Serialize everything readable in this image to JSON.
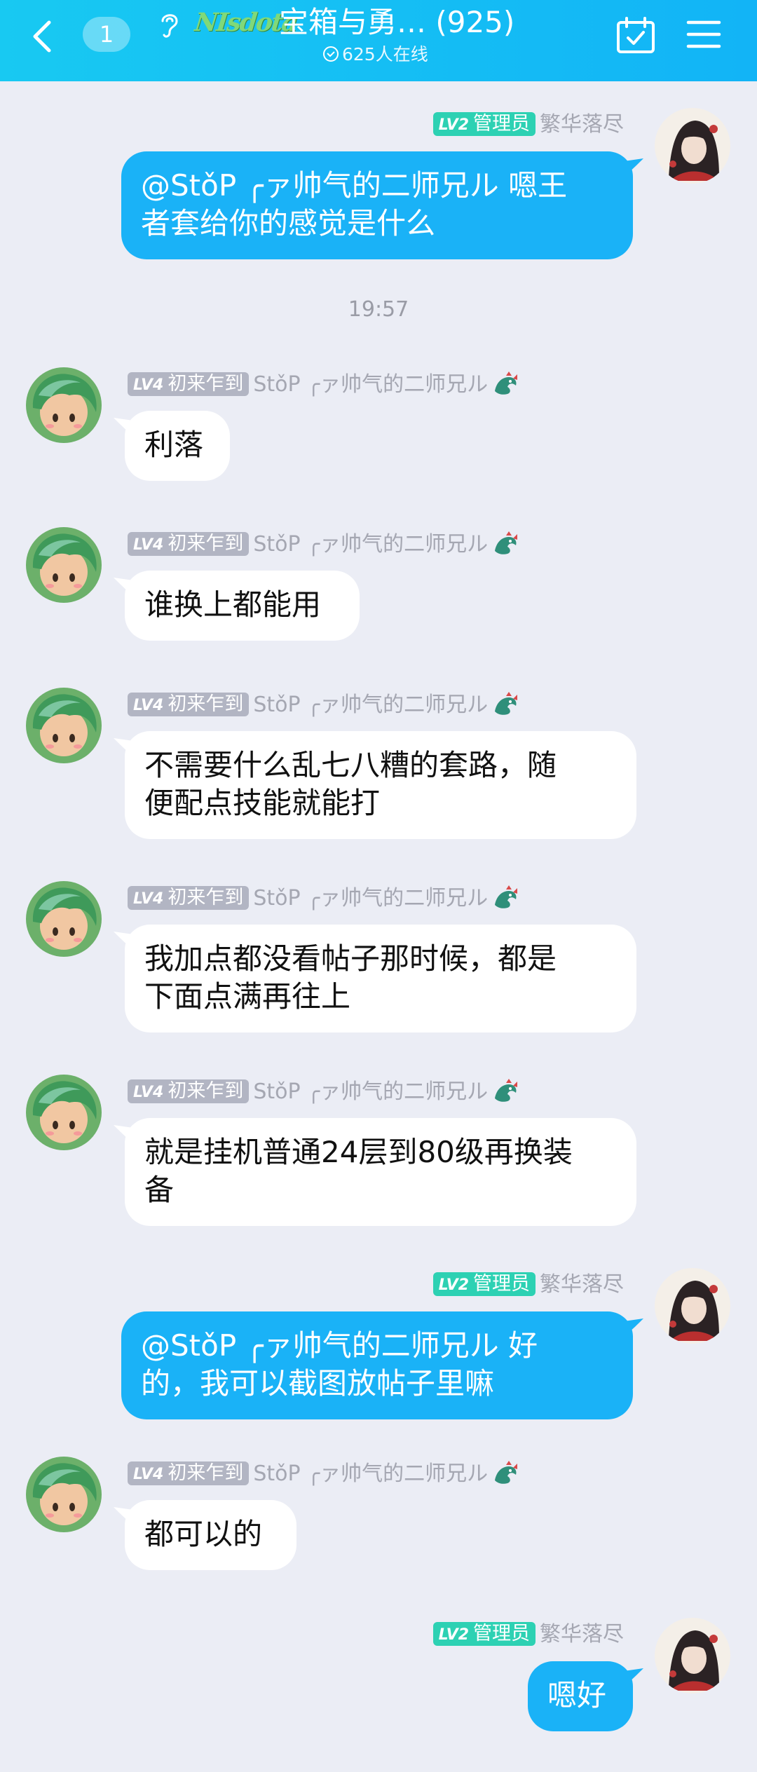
{
  "header": {
    "unread_count": "1",
    "group_logo": "NIsdota",
    "title": "宝箱与勇…  (925)",
    "online": "625人在线",
    "icons": [
      "back-icon",
      "ear-icon",
      "calendar-check-icon",
      "menu-icon"
    ]
  },
  "colors": {
    "header": "#18c9f2",
    "bubble_out": "#1ab2f7",
    "bubble_in": "#ffffff",
    "background": "#ebedf5",
    "lv4": "#b2b5c3",
    "lv2": "#2dd1b3"
  },
  "timestamp": "19:57",
  "messages": [
    {
      "side": "right",
      "level": "LV2",
      "role": "管理员",
      "name": "繁华落尽",
      "lines": [
        "@StǒP  ╭ァ帅气的二师兄ル 嗯王",
        "者套给你的感觉是什么"
      ]
    },
    {
      "side": "left",
      "level": "LV4",
      "role": "初来乍到",
      "name": "StǒP  ╭ァ帅气的二师兄ル",
      "lines": [
        "利落"
      ]
    },
    {
      "side": "left",
      "level": "LV4",
      "role": "初来乍到",
      "name": "StǒP  ╭ァ帅气的二师兄ル",
      "lines": [
        "谁换上都能用"
      ]
    },
    {
      "side": "left",
      "level": "LV4",
      "role": "初来乍到",
      "name": "StǒP  ╭ァ帅气的二师兄ル",
      "lines": [
        "不需要什么乱七八糟的套路，随",
        "便配点技能就能打"
      ]
    },
    {
      "side": "left",
      "level": "LV4",
      "role": "初来乍到",
      "name": "StǒP  ╭ァ帅气的二师兄ル",
      "lines": [
        "我加点都没看帖子那时候，都是",
        "下面点满再往上"
      ]
    },
    {
      "side": "left",
      "level": "LV4",
      "role": "初来乍到",
      "name": "StǒP  ╭ァ帅气的二师兄ル",
      "lines": [
        "就是挂机普通24层到80级再换装",
        "备"
      ]
    },
    {
      "side": "right",
      "level": "LV2",
      "role": "管理员",
      "name": "繁华落尽",
      "lines": [
        "@StǒP  ╭ァ帅气的二师兄ル 好",
        "的，我可以截图放帖子里嘛"
      ]
    },
    {
      "side": "left",
      "level": "LV4",
      "role": "初来乍到",
      "name": "StǒP  ╭ァ帅气的二师兄ル",
      "lines": [
        "都可以的"
      ]
    },
    {
      "side": "right",
      "level": "LV2",
      "role": "管理员",
      "name": "繁华落尽",
      "lines": [
        "嗯好"
      ]
    }
  ]
}
